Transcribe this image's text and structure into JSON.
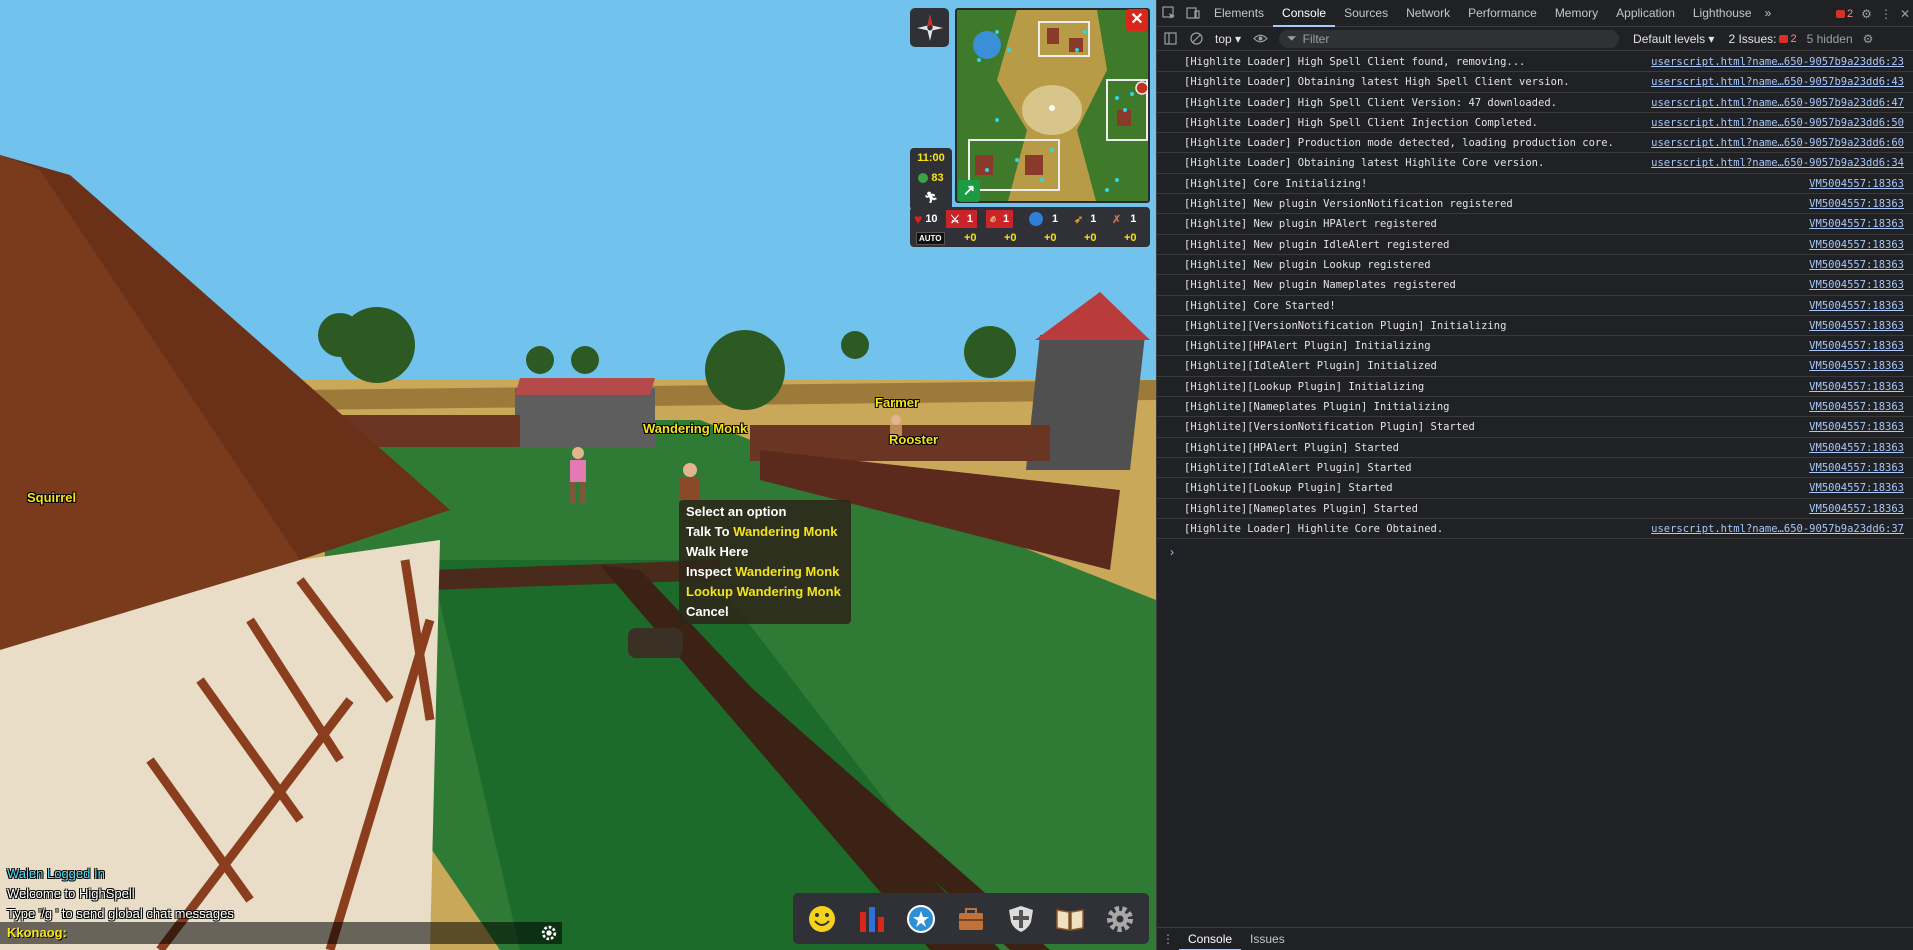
{
  "game": {
    "nameplates": {
      "squirrel": "Squirrel",
      "wandering_monk": "Wandering Monk",
      "farmer": "Farmer",
      "rooster": "Rooster"
    },
    "context_menu": {
      "header": "Select an option",
      "options": [
        {
          "action": "Talk To",
          "target": "Wandering Monk"
        },
        {
          "action": "Walk Here",
          "target": ""
        },
        {
          "action": "Inspect",
          "target": "Wandering Monk"
        },
        {
          "action": "Lookup",
          "target": "Wandering Monk",
          "highlighted": true
        },
        {
          "action": "Cancel",
          "target": ""
        }
      ]
    },
    "hud": {
      "time": "11:00",
      "energy": "83",
      "hitpoints": "10",
      "auto_label": "AUTO",
      "close_symbol": "✕",
      "arrow_symbol": "↗",
      "stats": [
        {
          "icon": "sword-icon",
          "value": "1",
          "bonus": "+0"
        },
        {
          "icon": "fist-icon",
          "value": "1",
          "bonus": "+0"
        },
        {
          "icon": "shield-icon",
          "value": "1",
          "bonus": "+0"
        },
        {
          "icon": "bow-icon",
          "value": "1",
          "bonus": "+0"
        },
        {
          "icon": "magic-icon",
          "value": "1",
          "bonus": "+0"
        }
      ]
    },
    "chat": {
      "lines": [
        {
          "text": "Walen Logged In",
          "type": "system"
        },
        {
          "text": "Welcome to HighSpell",
          "type": "normal"
        },
        {
          "text": "Type '/g ' to send global chat messages",
          "type": "normal"
        }
      ],
      "input_name": "Kkonaog:"
    },
    "toolbar": [
      "emote-icon",
      "stats-icon",
      "quests-icon",
      "inventory-icon",
      "equipment-icon",
      "spellbook-icon",
      "settings-icon"
    ],
    "colors": {
      "nameplate": "#f5e31c",
      "sky": "#71c3ee",
      "grass": "#1c6b2a"
    }
  },
  "devtools": {
    "tabs": [
      "Elements",
      "Console",
      "Sources",
      "Network",
      "Performance",
      "Memory",
      "Application",
      "Lighthouse"
    ],
    "active_tab": "Console",
    "more_tabs": "»",
    "error_count": "2",
    "toolbar": {
      "context": "top ▾",
      "filter_placeholder": "Filter",
      "levels": "Default levels ▾",
      "issues_label": "2 Issues:",
      "issues_count": "2",
      "hidden": "5 hidden"
    },
    "logs": [
      {
        "msg": "[Highlite Loader] High Spell Client found, removing...",
        "src": "userscript.html?name…650-9057b9a23dd6:23"
      },
      {
        "msg": "[Highlite Loader] Obtaining latest High Spell Client version.",
        "src": "userscript.html?name…650-9057b9a23dd6:43"
      },
      {
        "msg": "[Highlite Loader] High Spell Client Version: 47 downloaded.",
        "src": "userscript.html?name…650-9057b9a23dd6:47"
      },
      {
        "msg": "[Highlite Loader] High Spell Client Injection Completed.",
        "src": "userscript.html?name…650-9057b9a23dd6:50"
      },
      {
        "msg": "[Highlite Loader] Production mode detected, loading production core.",
        "src": "userscript.html?name…650-9057b9a23dd6:60"
      },
      {
        "msg": "[Highlite Loader] Obtaining latest Highlite Core version.",
        "src": "userscript.html?name…650-9057b9a23dd6:34"
      },
      {
        "msg": "[Highlite] Core Initializing!",
        "src": "VM5004557:18363"
      },
      {
        "msg": "[Highlite] New plugin VersionNotification registered",
        "src": "VM5004557:18363"
      },
      {
        "msg": "[Highlite] New plugin HPAlert registered",
        "src": "VM5004557:18363"
      },
      {
        "msg": "[Highlite] New plugin IdleAlert registered",
        "src": "VM5004557:18363"
      },
      {
        "msg": "[Highlite] New plugin Lookup registered",
        "src": "VM5004557:18363"
      },
      {
        "msg": "[Highlite] New plugin Nameplates registered",
        "src": "VM5004557:18363"
      },
      {
        "msg": "[Highlite] Core Started!",
        "src": "VM5004557:18363"
      },
      {
        "msg": "[Highlite][VersionNotification Plugin] Initializing",
        "src": "VM5004557:18363"
      },
      {
        "msg": "[Highlite][HPAlert Plugin] Initializing",
        "src": "VM5004557:18363"
      },
      {
        "msg": "[Highlite][IdleAlert Plugin] Initialized",
        "src": "VM5004557:18363"
      },
      {
        "msg": "[Highlite][Lookup Plugin] Initializing",
        "src": "VM5004557:18363"
      },
      {
        "msg": "[Highlite][Nameplates Plugin] Initializing",
        "src": "VM5004557:18363"
      },
      {
        "msg": "[Highlite][VersionNotification Plugin] Started",
        "src": "VM5004557:18363"
      },
      {
        "msg": "[Highlite][HPAlert Plugin] Started",
        "src": "VM5004557:18363"
      },
      {
        "msg": "[Highlite][IdleAlert Plugin] Started",
        "src": "VM5004557:18363"
      },
      {
        "msg": "[Highlite][Lookup Plugin] Started",
        "src": "VM5004557:18363"
      },
      {
        "msg": "[Highlite][Nameplates Plugin] Started",
        "src": "VM5004557:18363"
      },
      {
        "msg": "[Highlite Loader] Highlite Core Obtained.",
        "src": "userscript.html?name…650-9057b9a23dd6:37"
      }
    ],
    "prompt": "›",
    "drawer_tabs": [
      "Console",
      "Issues"
    ],
    "drawer_active": "Console"
  }
}
